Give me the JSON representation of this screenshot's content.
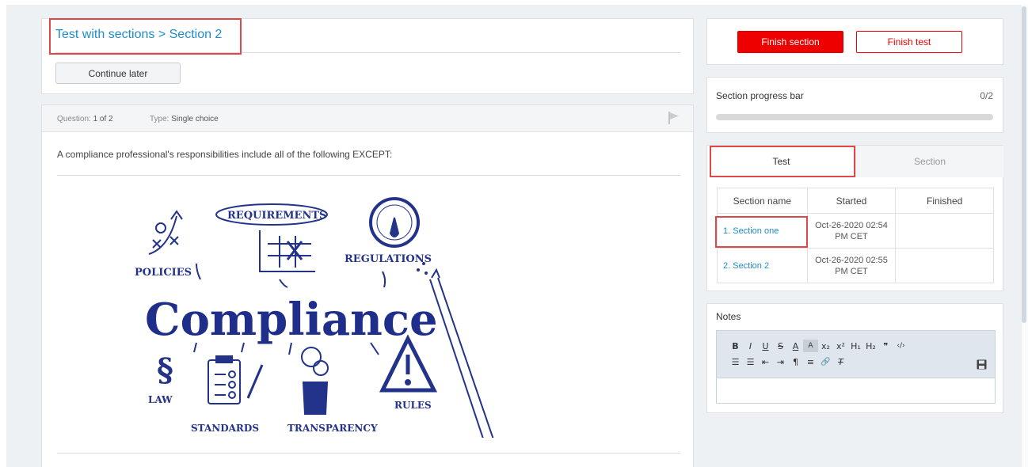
{
  "header": {
    "title": "Test with sections > Section 2",
    "continue_label": "Continue later"
  },
  "question": {
    "number_label": "Question:",
    "number_value": "1 of 2",
    "type_label": "Type:",
    "type_value": "Single choice",
    "text": "A compliance professional's responsibilities include all of the following EXCEPT:",
    "image_words": {
      "main": "Compliance",
      "policies": "POLICIES",
      "requirements": "REQUIREMENTS",
      "regulations": "REGULATIONS",
      "law": "LAW",
      "standards": "STANDARDS",
      "transparency": "TRANSPARENCY",
      "rules": "RULES"
    }
  },
  "actions": {
    "finish_section": "Finish section",
    "finish_test": "Finish test"
  },
  "progress": {
    "label": "Section progress bar",
    "count": "0/2",
    "fraction": 0
  },
  "tabs": [
    {
      "label": "Test",
      "active": true
    },
    {
      "label": "Section",
      "active": false
    }
  ],
  "sections_table": {
    "headers": [
      "Section name",
      "Started",
      "Finished"
    ],
    "rows": [
      {
        "name": "1. Section one",
        "started": "Oct-26-2020 02:54 PM CET",
        "finished": ""
      },
      {
        "name": "2. Section 2",
        "started": "Oct-26-2020 02:55 PM CET",
        "finished": ""
      }
    ]
  },
  "notes": {
    "label": "Notes",
    "toolbar_row1": [
      "B",
      "I",
      "U",
      "S",
      "A",
      "A",
      "x₂",
      "x²",
      "H₁",
      "H₂",
      "❞",
      "‹/›"
    ],
    "toolbar_row2": [
      "☰",
      "☰",
      "⇤",
      "⇥",
      "¶",
      "≡",
      "🔗",
      "T"
    ]
  },
  "colors": {
    "accent": "#1f8bc8",
    "danger": "#ee0000",
    "highlight": "#e04848",
    "page_bg": "#eef1f4"
  },
  "icons": [
    "flag-icon",
    "save-icon",
    "bold-icon",
    "italic-icon",
    "underline-icon",
    "strikethrough-icon",
    "link-icon"
  ]
}
